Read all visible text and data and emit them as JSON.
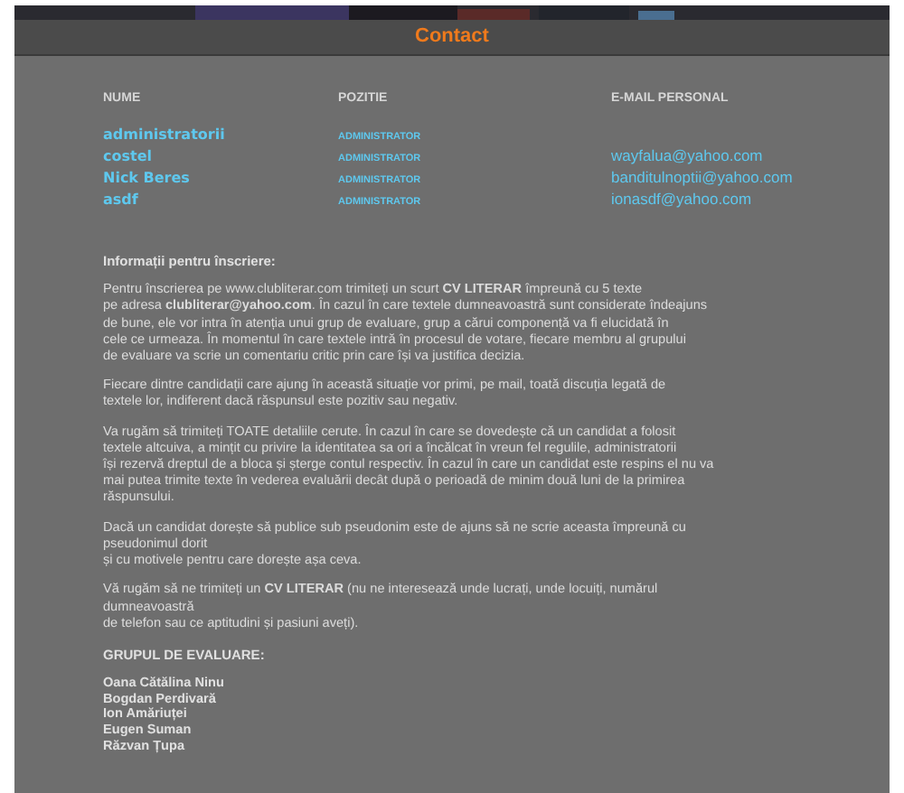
{
  "page_title": "Contact",
  "table": {
    "columns": [
      "NUME",
      "POZITIE",
      "E-MAIL PERSONAL"
    ],
    "rows": [
      {
        "name": "administratorii",
        "position": "ADMINISTRATOR"
      },
      {
        "name": "costel",
        "position": "ADMINISTRATOR",
        "email": "wayfalua@yahoo.com"
      },
      {
        "name": "Nick Beres",
        "position": "ADMINISTRATOR",
        "email": "banditulnoptii@yahoo.com"
      },
      {
        "name": "asdf",
        "position": "ADMINISTRATOR",
        "email": "ionasdf@yahoo.com"
      }
    ]
  },
  "info_heading": "Informații pentru înscriere:",
  "paragraphs": [
    [
      "Pentru înscrierea pe www.clubliterar.com trimiteți un scurt **CV LITERAR** împreună cu 5 texte",
      "pe adresa **clubliterar@yahoo.com**. În cazul în care textele dumneavoastră sunt considerate îndeajuns",
      "de bune, ele vor intra în atenția unui grup de evaluare, grup a cărui componență va fi elucidată în",
      "cele ce urmeaza. În momentul în care textele intră în procesul de votare, fiecare membru al grupului",
      "de evaluare va scrie un comentariu critic prin care își va justifica decizia."
    ],
    [
      "Fiecare dintre candidații care ajung în această situație vor primi, pe mail, toată discuția legată de",
      "textele lor, indiferent dacă răspunsul este pozitiv sau negativ."
    ],
    [
      "Va rugăm să trimiteți TOATE detaliile cerute. În cazul în care se dovedește că un candidat a folosit",
      "textele altcuiva, a mințit cu privire la identitatea sa ori a încălcat în vreun fel regulile, administratorii",
      "își rezervă dreptul de a bloca și șterge contul respectiv. În cazul în care un candidat este respins el nu va",
      "mai putea trimite texte în vederea evaluării decât după o perioadă de minim două luni de la primirea",
      "răspunsului."
    ],
    [
      "Dacă un candidat dorește să publice sub pseudonim este de ajuns să ne scrie aceasta împreună cu",
      "pseudonimul dorit",
      "și cu motivele pentru care dorește așa ceva."
    ],
    [
      "Vă rugăm să ne trimiteți un **CV LITERAR** (nu ne interesează unde lucrați, unde locuiți, numărul",
      "dumneavoastră",
      "de telefon sau ce aptitudini și pasiuni aveți)."
    ]
  ],
  "group_heading": "GRUPUL DE EVALUARE:",
  "group_members": [
    "Oana Cătălina Ninu",
    "Bogdan Perdivară",
    "Ion Amăriuței",
    "Eugen Suman",
    "Răzvan Țupa"
  ]
}
